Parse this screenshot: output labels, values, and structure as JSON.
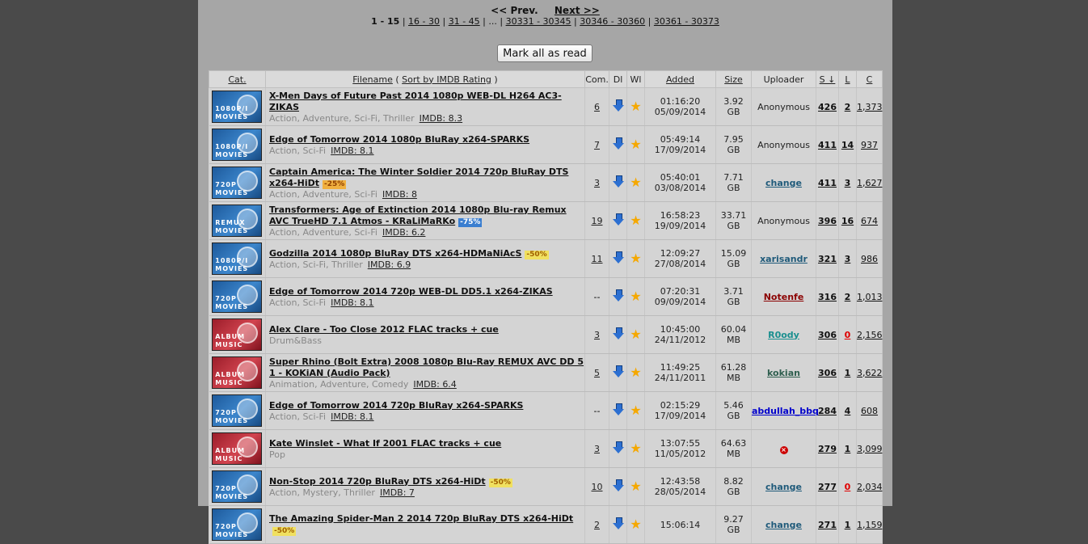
{
  "pagination": {
    "prev": "<< Prev.",
    "next": "Next >>",
    "current": "1 - 15",
    "links": [
      "16 - 30",
      "31 - 45",
      "...",
      "30331 - 30345",
      "30346 - 30360",
      "30361 - 30373"
    ]
  },
  "mark_all_label": "Mark all as read",
  "headers": {
    "cat": "Cat.",
    "filename": "Filename",
    "sort_imdb": "Sort by IMDB Rating",
    "com": "Com.",
    "dl": "Dl",
    "wl": "Wl",
    "added": "Added",
    "size": "Size",
    "uploader": "Uploader",
    "seeders": "S ↓",
    "leechers": "L",
    "completed": "C"
  },
  "rows": [
    {
      "cat_l1": "1080P/I",
      "cat_l2": "MOVIES",
      "cat_type": "movies",
      "name": "X-Men Days of Future Past 2014 1080p WEB-DL H264 AC3-ZIKAS",
      "badge": "",
      "badge_type": "",
      "genres": "Action, Adventure, Sci-Fi, Thriller",
      "imdb": "IMDB: 8.3",
      "com": "6",
      "time": "01:16:20",
      "date": "05/09/2014",
      "size": "3.92 GB",
      "uploader": "Anonymous",
      "uploader_color": "",
      "seeders": "426",
      "leechers": "2",
      "completed": "1,373"
    },
    {
      "cat_l1": "1080P/I",
      "cat_l2": "MOVIES",
      "cat_type": "movies",
      "name": "Edge of Tomorrow 2014 1080p BluRay x264-SPARKS",
      "badge": "",
      "badge_type": "",
      "genres": "Action, Sci-Fi",
      "imdb": "IMDB: 8.1",
      "com": "7",
      "time": "05:49:14",
      "date": "17/09/2014",
      "size": "7.95 GB",
      "uploader": "Anonymous",
      "uploader_color": "",
      "seeders": "411",
      "leechers": "14",
      "completed": "937"
    },
    {
      "cat_l1": "720P",
      "cat_l2": "MOVIES",
      "cat_type": "movies",
      "name": "Captain America: The Winter Soldier 2014 720p BluRay DTS x264-HiDt",
      "badge": "-25%",
      "badge_type": "org",
      "genres": "Action, Adventure, Sci-Fi",
      "imdb": "IMDB: 8",
      "com": "3",
      "time": "05:40:01",
      "date": "03/08/2014",
      "size": "7.71 GB",
      "uploader": "change",
      "uploader_color": "#1f5a7a",
      "seeders": "411",
      "leechers": "3",
      "completed": "1,627"
    },
    {
      "cat_l1": "REMUX",
      "cat_l2": "MOVIES",
      "cat_type": "movies",
      "name": "Transformers: Age of Extinction 2014 1080p Blu-ray Remux AVC TrueHD 7.1 Atmos - KRaLiMaRKo",
      "badge": "-75%",
      "badge_type": "blu",
      "genres": "Action, Adventure, Sci-Fi",
      "imdb": "IMDB: 6.2",
      "com": "19",
      "time": "16:58:23",
      "date": "19/09/2014",
      "size": "33.71 GB",
      "uploader": "Anonymous",
      "uploader_color": "",
      "seeders": "396",
      "leechers": "16",
      "completed": "674"
    },
    {
      "cat_l1": "1080P/I",
      "cat_l2": "MOVIES",
      "cat_type": "movies",
      "name": "Godzilla 2014 1080p BluRay DTS x264-HDMaNiAcS",
      "badge": "-50%",
      "badge_type": "yel",
      "genres": "Action, Sci-Fi, Thriller",
      "imdb": "IMDB: 6.9",
      "com": "11",
      "time": "12:09:27",
      "date": "27/08/2014",
      "size": "15.09 GB",
      "uploader": "xarisandr",
      "uploader_color": "#1f5a7a",
      "seeders": "321",
      "leechers": "3",
      "completed": "986"
    },
    {
      "cat_l1": "720P",
      "cat_l2": "MOVIES",
      "cat_type": "movies",
      "name": "Edge of Tomorrow 2014 720p WEB-DL DD5.1 x264-ZIKAS",
      "badge": "",
      "badge_type": "",
      "genres": "Action, Sci-Fi",
      "imdb": "IMDB: 8.1",
      "com": "--",
      "time": "07:20:31",
      "date": "09/09/2014",
      "size": "3.71 GB",
      "uploader": "Notenfe",
      "uploader_color": "#8b0000",
      "seeders": "316",
      "leechers": "2",
      "completed": "1,013"
    },
    {
      "cat_l1": "ALBUM",
      "cat_l2": "MUSIC",
      "cat_type": "music",
      "name": "Alex Clare - Too Close 2012 FLAC tracks + cue",
      "badge": "",
      "badge_type": "",
      "genres": "Drum&Bass",
      "imdb": "",
      "com": "3",
      "time": "10:45:00",
      "date": "24/11/2012",
      "size": "60.04 MB",
      "uploader": "R0ody",
      "uploader_color": "#1a8f8f",
      "seeders": "306",
      "leechers": "0",
      "completed": "2,156"
    },
    {
      "cat_l1": "ALBUM",
      "cat_l2": "MUSIC",
      "cat_type": "music",
      "name": "Super Rhino (Bolt Extra) 2008 1080p Blu-Ray REMUX AVC DD 5 1 - KOKiAN (Audio Pack)",
      "badge": "",
      "badge_type": "",
      "genres": "Animation, Adventure, Comedy",
      "imdb": "IMDB: 6.4",
      "com": "5",
      "time": "11:49:25",
      "date": "24/11/2011",
      "size": "61.28 MB",
      "uploader": "kokian",
      "uploader_color": "#2f5f4f",
      "seeders": "306",
      "leechers": "1",
      "completed": "3,622"
    },
    {
      "cat_l1": "720P",
      "cat_l2": "MOVIES",
      "cat_type": "movies",
      "name": "Edge of Tomorrow 2014 720p BluRay x264-SPARKS",
      "badge": "",
      "badge_type": "",
      "genres": "Action, Sci-Fi",
      "imdb": "IMDB: 8.1",
      "com": "--",
      "time": "02:15:29",
      "date": "17/09/2014",
      "size": "5.46 GB",
      "uploader": "abdullah_bbq",
      "uploader_color": "#0000cc",
      "seeders": "284",
      "leechers": "4",
      "completed": "608"
    },
    {
      "cat_l1": "ALBUM",
      "cat_l2": "MUSIC",
      "cat_type": "music",
      "name": "Kate Winslet - What If 2001 FLAC tracks + cue",
      "badge": "",
      "badge_type": "",
      "genres": "Pop",
      "imdb": "",
      "com": "3",
      "time": "13:07:55",
      "date": "11/05/2012",
      "size": "64.63 MB",
      "uploader": "",
      "uploader_color": "",
      "uploader_icon": "banned-icon",
      "seeders": "279",
      "leechers": "1",
      "completed": "3,099"
    },
    {
      "cat_l1": "720P",
      "cat_l2": "MOVIES",
      "cat_type": "movies",
      "name": "Non-Stop 2014 720p BluRay DTS x264-HiDt",
      "badge": "-50%",
      "badge_type": "yel",
      "genres": "Action, Mystery, Thriller",
      "imdb": "IMDB: 7",
      "com": "10",
      "time": "12:43:58",
      "date": "28/05/2014",
      "size": "8.82 GB",
      "uploader": "change",
      "uploader_color": "#1f5a7a",
      "seeders": "277",
      "leechers": "0",
      "completed": "2,034"
    },
    {
      "cat_l1": "720P",
      "cat_l2": "MOVIES",
      "cat_type": "movies",
      "name": "The Amazing Spider-Man 2 2014 720p BluRay DTS x264-HiDt",
      "badge": "-50%",
      "badge_type": "yel",
      "genres": "",
      "imdb": "",
      "com": "2",
      "time": "15:06:14",
      "date": "",
      "size": "9.27 GB",
      "uploader": "change",
      "uploader_color": "#1f5a7a",
      "seeders": "271",
      "leechers": "1",
      "completed": "1,159"
    }
  ]
}
